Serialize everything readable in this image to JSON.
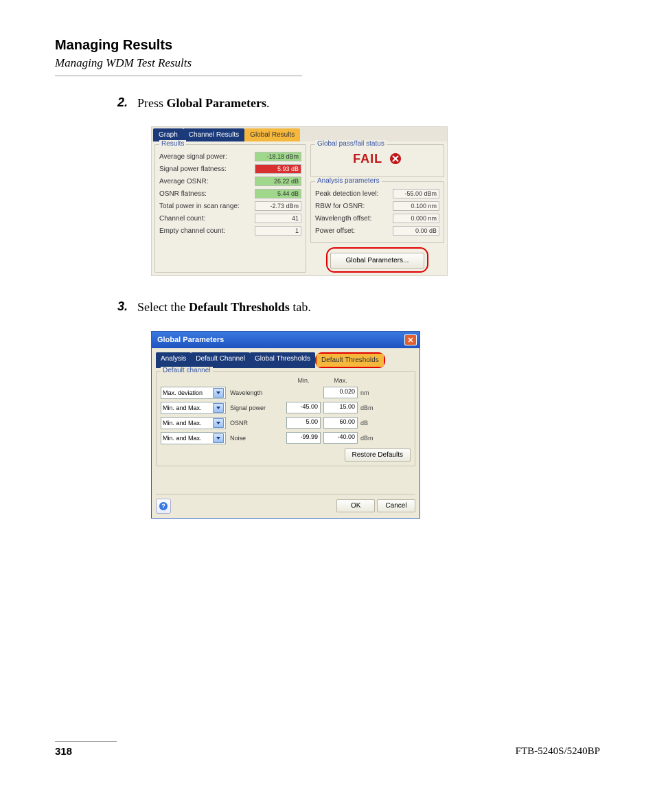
{
  "header": {
    "title": "Managing Results",
    "subtitle": "Managing WDM Test Results"
  },
  "steps": {
    "s2": {
      "num": "2.",
      "prefix": "Press ",
      "bold": "Global Parameters",
      "suffix": "."
    },
    "s3": {
      "num": "3.",
      "prefix": "Select the ",
      "bold": "Default Thresholds",
      "suffix": " tab."
    }
  },
  "shot1": {
    "tabs": {
      "graph": "Graph",
      "channel": "Channel Results",
      "global": "Global Results"
    },
    "results": {
      "title": "Results",
      "rows": {
        "avg_sig": {
          "label": "Average signal power:",
          "value": "-18.18 dBm",
          "cls": "green"
        },
        "flatness": {
          "label": "Signal power flatness:",
          "value": "5.93 dB",
          "cls": "red"
        },
        "avg_osnr": {
          "label": "Average OSNR:",
          "value": "26.22 dB",
          "cls": "green"
        },
        "osnr_flat": {
          "label": "OSNR flatness:",
          "value": "5.44 dB",
          "cls": "green"
        },
        "total_pwr": {
          "label": "Total power in scan range:",
          "value": "-2.73 dBm",
          "cls": "plain"
        },
        "ch_count": {
          "label": "Channel count:",
          "value": "41",
          "cls": "plain"
        },
        "empty_ch": {
          "label": "Empty channel count:",
          "value": "1",
          "cls": "plain"
        }
      }
    },
    "passfail": {
      "title": "Global pass/fail status",
      "status": "FAIL"
    },
    "analysis": {
      "title": "Analysis parameters",
      "rows": {
        "peak": {
          "label": "Peak detection level:",
          "value": "-55.00 dBm"
        },
        "rbw": {
          "label": "RBW for OSNR:",
          "value": "0.100 nm"
        },
        "wloff": {
          "label": "Wavelength offset:",
          "value": "0.000 nm"
        },
        "poff": {
          "label": "Power offset:",
          "value": "0.00 dB"
        }
      }
    },
    "button": "Global Parameters..."
  },
  "shot2": {
    "title": "Global Parameters",
    "tabs": {
      "analysis": "Analysis",
      "defch": "Default Channel",
      "globth": "Global Thresholds",
      "defth": "Default Thresholds"
    },
    "group_title": "Default channel",
    "headers": {
      "min": "Min.",
      "max": "Max."
    },
    "rows": {
      "wavelength": {
        "mode": "Max. deviation",
        "label": "Wavelength",
        "min": "",
        "max": "0.020",
        "unit": "nm"
      },
      "signal": {
        "mode": "Min. and Max.",
        "label": "Signal power",
        "min": "-45.00",
        "max": "15.00",
        "unit": "dBm"
      },
      "osnr": {
        "mode": "Min. and Max.",
        "label": "OSNR",
        "min": "5.00",
        "max": "60.00",
        "unit": "dB"
      },
      "noise": {
        "mode": "Min. and Max.",
        "label": "Noise",
        "min": "-99.99",
        "max": "-40.00",
        "unit": "dBm"
      }
    },
    "restore": "Restore Defaults",
    "ok": "OK",
    "cancel": "Cancel"
  },
  "footer": {
    "page": "318",
    "model": "FTB-5240S/5240BP"
  }
}
